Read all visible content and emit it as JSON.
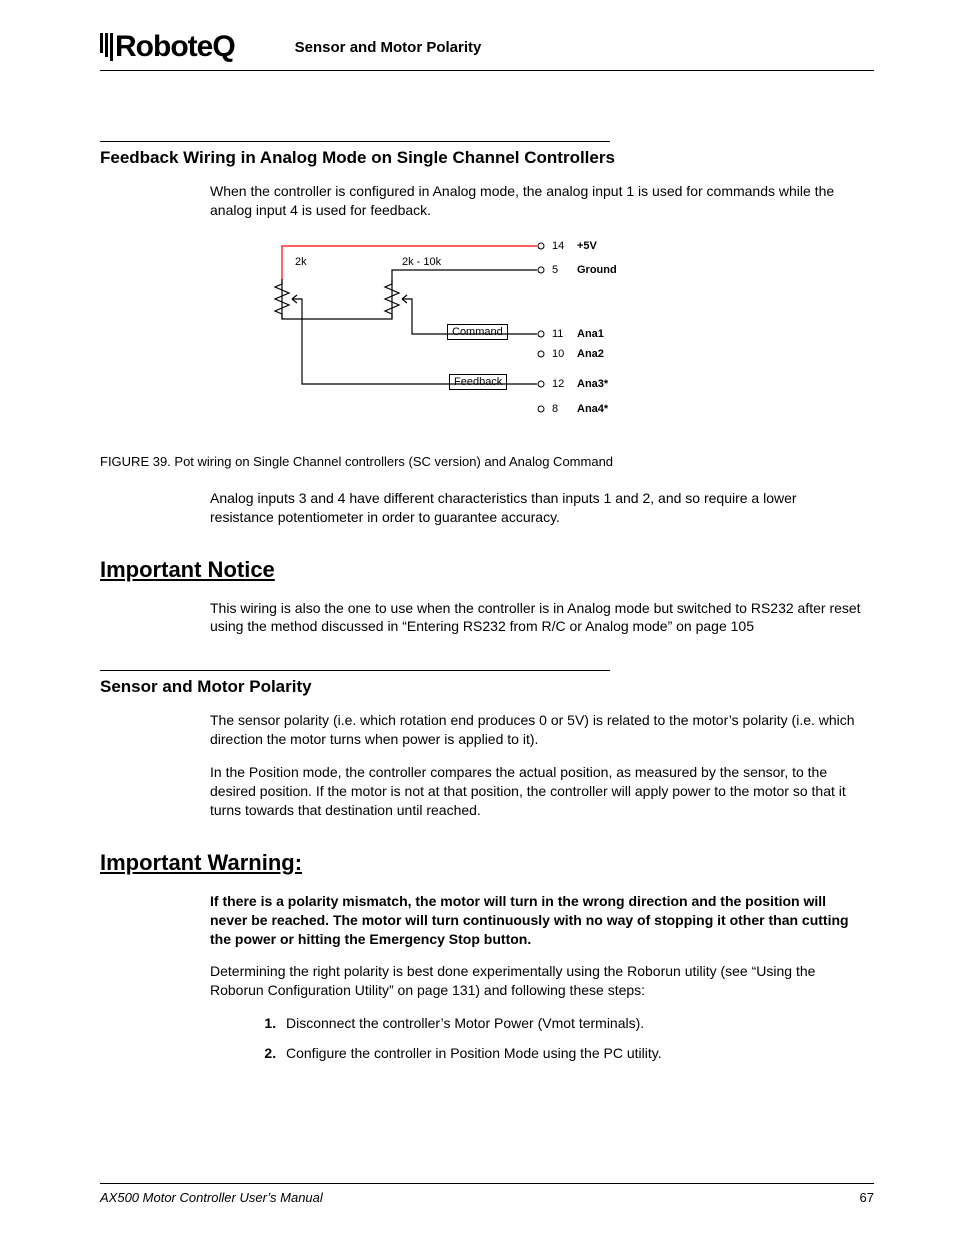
{
  "header": {
    "brand_part1": "Robote",
    "brand_part2": "Q",
    "title": "Sensor and Motor Polarity"
  },
  "section1": {
    "heading": "Feedback Wiring in Analog Mode on Single Channel Controllers",
    "p1": "When the controller is configured in Analog mode, the analog input 1 is used for commands while the analog input 4 is used for feedback."
  },
  "diagram": {
    "r1": "2k",
    "r2": "2k - 10k",
    "lbl_command": "Command",
    "lbl_feedback": "Feedback",
    "pins": [
      {
        "num": "14",
        "name": "+5V"
      },
      {
        "num": "5",
        "name": "Ground"
      },
      {
        "num": "11",
        "name": "Ana1"
      },
      {
        "num": "10",
        "name": "Ana2"
      },
      {
        "num": "12",
        "name": "Ana3*"
      },
      {
        "num": "8",
        "name": "Ana4*"
      }
    ],
    "caption": "FIGURE 39. Pot wiring on Single Channel controllers (SC version) and Analog Command"
  },
  "section2": {
    "p1": "Analog inputs 3 and 4 have different characteristics than inputs 1 and 2, and so require a lower resistance potentiometer in order to guarantee accuracy."
  },
  "notice": {
    "heading": "Important Notice",
    "p1": "This wiring is also the one to use when the controller is in Analog mode but switched to RS232 after reset using the method discussed in “Entering RS232 from R/C or Analog mode” on page 105"
  },
  "section3": {
    "heading": "Sensor and Motor Polarity",
    "p1": "The sensor polarity (i.e. which rotation end produces 0 or 5V) is related to the motor’s polarity (i.e. which direction the motor turns when power is applied to it).",
    "p2": "In the Position mode, the controller compares the actual position, as measured by the sensor, to the desired position. If the motor is not at that position, the controller will apply power to the motor so that it turns towards that destination until reached."
  },
  "warning": {
    "heading": "Important Warning:",
    "p1": "If there is a polarity mismatch, the motor will turn in the wrong direction and the position will never be reached. The motor will turn continuously with no way of stopping it other than cutting the power or hitting the Emergency Stop button.",
    "p2": "Determining the right polarity is best done experimentally using the Roborun utility (see “Using the Roborun Configuration Utility” on page 131) and following these steps:",
    "steps": [
      "Disconnect the controller’s Motor Power (Vmot terminals).",
      "Configure the controller in Position Mode using the PC utility."
    ]
  },
  "footer": {
    "manual": "AX500 Motor Controller User’s Manual",
    "page": "67"
  }
}
